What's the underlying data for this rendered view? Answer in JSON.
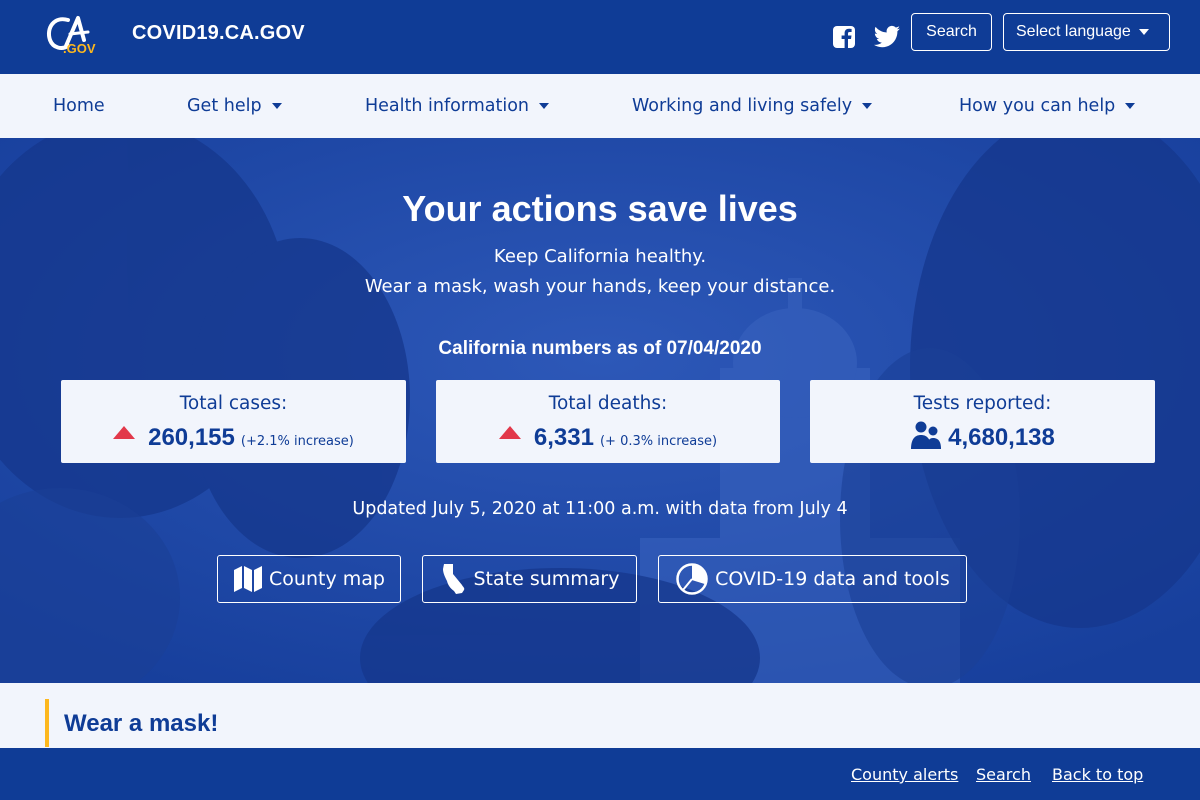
{
  "header": {
    "logo_text": "CA.GOV",
    "site_title": "COVID19.CA.GOV",
    "search_label": "Search",
    "language_label": "Select language"
  },
  "nav": {
    "items": [
      {
        "label": "Home"
      },
      {
        "label": "Get help"
      },
      {
        "label": "Health information"
      },
      {
        "label": "Working and living safely"
      },
      {
        "label": "How you can help"
      }
    ]
  },
  "hero": {
    "title": "Your actions save lives",
    "line1": "Keep California healthy.",
    "line2": "Wear a mask, wash your hands, keep your distance.",
    "numbers_heading": "California numbers as of 07/04/2020",
    "stats": [
      {
        "label": "Total cases:",
        "value": "260,155",
        "change": "(+2.1% increase)",
        "icon": "red-up-arrow-icon"
      },
      {
        "label": "Total deaths:",
        "value": "6,331",
        "change": "(+ 0.3% increase)",
        "icon": "red-up-arrow-icon"
      },
      {
        "label": "Tests reported:",
        "value": "4,680,138",
        "change": "",
        "icon": "people-icon"
      }
    ],
    "updated": "Updated July 5, 2020 at 11:00 a.m. with data from July 4",
    "buttons": [
      {
        "label": "County map",
        "icon": "map-icon"
      },
      {
        "label": "State summary",
        "icon": "california-icon"
      },
      {
        "label": "COVID-19 data and tools",
        "icon": "pie-chart-icon"
      }
    ]
  },
  "section": {
    "alert_title": "Wear a mask!"
  },
  "footer": {
    "links": [
      {
        "label": "County alerts"
      },
      {
        "label": "Search"
      },
      {
        "label": "Back to top"
      }
    ]
  },
  "colors": {
    "header_bg": "#0f3c96",
    "nav_bg": "#f2f5fc",
    "hero_bg": "#1e47a6",
    "accent_gold": "#fdb81e",
    "increase_red": "#e2384a",
    "text_blue": "#0f3c96"
  }
}
